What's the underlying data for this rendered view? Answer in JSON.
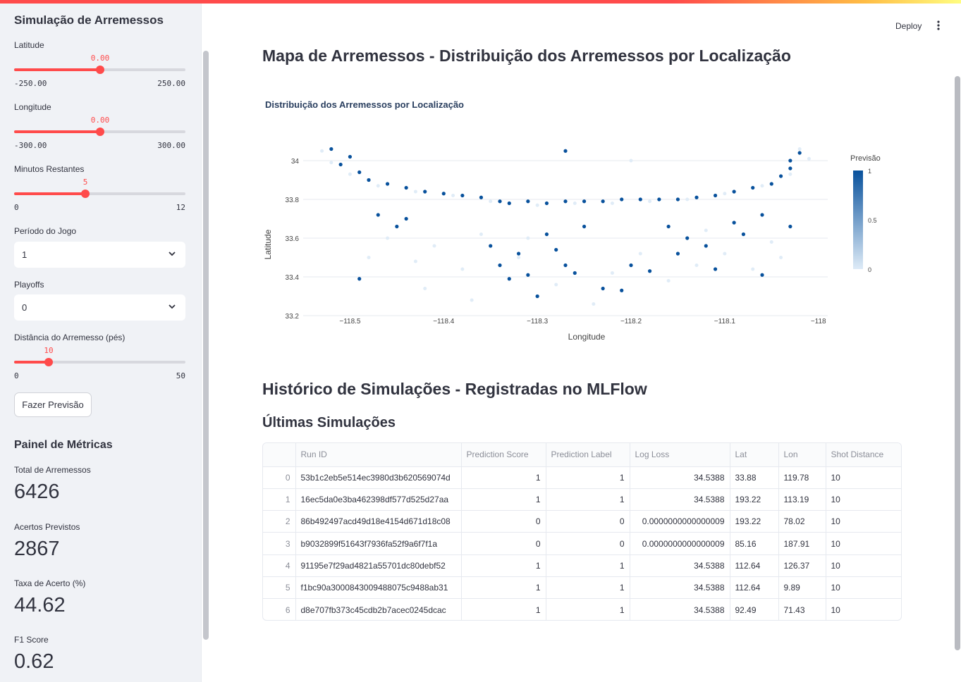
{
  "sidebar": {
    "title": "Simulação de Arremessos",
    "sliders": [
      {
        "label": "Latitude",
        "value": "0.00",
        "min": "-250.00",
        "max": "250.00",
        "fraction": 0.5
      },
      {
        "label": "Longitude",
        "value": "0.00",
        "min": "-300.00",
        "max": "300.00",
        "fraction": 0.5
      },
      {
        "label": "Minutos Restantes",
        "value": "5",
        "min": "0",
        "max": "12",
        "fraction": 0.4167
      },
      {
        "label": "Distância do Arremesso (pés)",
        "value": "10",
        "min": "0",
        "max": "50",
        "fraction": 0.2
      }
    ],
    "selects": [
      {
        "label": "Período do Jogo",
        "value": "1"
      },
      {
        "label": "Playoffs",
        "value": "0"
      }
    ],
    "button": "Fazer Previsão",
    "metrics_title": "Painel de Métricas",
    "metrics": [
      {
        "label": "Total de Arremessos",
        "value": "6426"
      },
      {
        "label": "Acertos Previstos",
        "value": "2867"
      },
      {
        "label": "Taxa de Acerto (%)",
        "value": "44.62"
      },
      {
        "label": "F1 Score",
        "value": "0.62"
      }
    ]
  },
  "header": {
    "deploy": "Deploy"
  },
  "main": {
    "map_title": "Mapa de Arremessos - Distribuição dos Arremessos por Localização",
    "history_title": "Histórico de Simulações - Registradas no MLFlow",
    "last_title": "Últimas Simulações"
  },
  "chart_data": {
    "type": "scatter",
    "title": "Distribuição dos Arremessos por Localização",
    "xlabel": "Longitude",
    "ylabel": "Latitude",
    "xlim": [
      -118.55,
      -117.99
    ],
    "ylim": [
      33.2,
      34.08
    ],
    "x_ticks": [
      "−118.5",
      "−118.4",
      "−118.3",
      "−118.2",
      "−118.1",
      "−118"
    ],
    "x_tick_values": [
      -118.5,
      -118.4,
      -118.3,
      -118.2,
      -118.1,
      -118.0
    ],
    "y_ticks": [
      "34",
      "33.8",
      "33.6",
      "33.4",
      "33.2"
    ],
    "y_tick_values": [
      34.0,
      33.8,
      33.6,
      33.4,
      33.2
    ],
    "colorbar": {
      "title": "Previsão",
      "ticks": [
        "1",
        "0.5",
        "0"
      ],
      "low_color": "#deebf7",
      "high_color": "#08519c"
    },
    "grid": true,
    "points_hit": [
      [
        -118.52,
        34.06
      ],
      [
        -118.5,
        34.02
      ],
      [
        -118.51,
        33.98
      ],
      [
        -118.49,
        33.94
      ],
      [
        -118.48,
        33.9
      ],
      [
        -118.46,
        33.88
      ],
      [
        -118.44,
        33.86
      ],
      [
        -118.42,
        33.84
      ],
      [
        -118.4,
        33.83
      ],
      [
        -118.38,
        33.82
      ],
      [
        -118.36,
        33.81
      ],
      [
        -118.34,
        33.79
      ],
      [
        -118.33,
        33.78
      ],
      [
        -118.31,
        33.79
      ],
      [
        -118.29,
        33.78
      ],
      [
        -118.27,
        33.79
      ],
      [
        -118.25,
        33.79
      ],
      [
        -118.23,
        33.79
      ],
      [
        -118.21,
        33.8
      ],
      [
        -118.19,
        33.8
      ],
      [
        -118.17,
        33.8
      ],
      [
        -118.15,
        33.8
      ],
      [
        -118.13,
        33.81
      ],
      [
        -118.11,
        33.82
      ],
      [
        -118.09,
        33.84
      ],
      [
        -118.07,
        33.86
      ],
      [
        -118.05,
        33.88
      ],
      [
        -118.04,
        33.92
      ],
      [
        -118.03,
        33.96
      ],
      [
        -118.03,
        34.0
      ],
      [
        -118.02,
        34.04
      ],
      [
        -118.27,
        34.05
      ],
      [
        -118.47,
        33.72
      ],
      [
        -118.45,
        33.66
      ],
      [
        -118.44,
        33.7
      ],
      [
        -118.49,
        33.39
      ],
      [
        -118.35,
        33.56
      ],
      [
        -118.34,
        33.46
      ],
      [
        -118.32,
        33.52
      ],
      [
        -118.31,
        33.41
      ],
      [
        -118.3,
        33.3
      ],
      [
        -118.28,
        33.54
      ],
      [
        -118.27,
        33.46
      ],
      [
        -118.26,
        33.42
      ],
      [
        -118.23,
        33.34
      ],
      [
        -118.21,
        33.33
      ],
      [
        -118.2,
        33.46
      ],
      [
        -118.18,
        33.43
      ],
      [
        -118.15,
        33.52
      ],
      [
        -118.14,
        33.6
      ],
      [
        -118.12,
        33.56
      ],
      [
        -118.11,
        33.44
      ],
      [
        -118.09,
        33.68
      ],
      [
        -118.08,
        33.62
      ],
      [
        -118.06,
        33.41
      ],
      [
        -118.03,
        33.66
      ],
      [
        -118.25,
        33.66
      ],
      [
        -118.29,
        33.62
      ],
      [
        -118.16,
        33.66
      ],
      [
        -118.06,
        33.72
      ],
      [
        -118.33,
        33.39
      ]
    ],
    "points_miss": [
      [
        -118.53,
        34.05
      ],
      [
        -118.52,
        33.99
      ],
      [
        -118.5,
        33.93
      ],
      [
        -118.47,
        33.87
      ],
      [
        -118.43,
        33.84
      ],
      [
        -118.39,
        33.82
      ],
      [
        -118.35,
        33.79
      ],
      [
        -118.3,
        33.77
      ],
      [
        -118.26,
        33.78
      ],
      [
        -118.22,
        33.78
      ],
      [
        -118.18,
        33.79
      ],
      [
        -118.14,
        33.8
      ],
      [
        -118.1,
        33.83
      ],
      [
        -118.06,
        33.87
      ],
      [
        -118.03,
        33.93
      ],
      [
        -118.01,
        34.01
      ],
      [
        -118.02,
        34.06
      ],
      [
        -118.46,
        33.6
      ],
      [
        -118.43,
        33.48
      ],
      [
        -118.41,
        33.56
      ],
      [
        -118.38,
        33.44
      ],
      [
        -118.36,
        33.62
      ],
      [
        -118.32,
        33.5
      ],
      [
        -118.28,
        33.36
      ],
      [
        -118.24,
        33.26
      ],
      [
        -118.22,
        33.42
      ],
      [
        -118.19,
        33.52
      ],
      [
        -118.16,
        33.38
      ],
      [
        -118.13,
        33.46
      ],
      [
        -118.1,
        33.52
      ],
      [
        -118.07,
        33.44
      ],
      [
        -118.05,
        33.58
      ],
      [
        -118.2,
        34.0
      ],
      [
        -118.42,
        33.34
      ],
      [
        -118.37,
        33.28
      ],
      [
        -118.31,
        33.6
      ],
      [
        -118.48,
        33.5
      ],
      [
        -118.12,
        33.64
      ],
      [
        -118.04,
        33.5
      ]
    ]
  },
  "table": {
    "columns": [
      "",
      "Run ID",
      "Prediction Score",
      "Prediction Label",
      "Log Loss",
      "Lat",
      "Lon",
      "Shot Distance"
    ],
    "rows": [
      [
        "0",
        "53b1c2eb5e514ec3980d3b620569074d",
        "1",
        "1",
        "34.5388",
        "33.88",
        "119.78",
        "10"
      ],
      [
        "1",
        "16ec5da0e3ba462398df577d525d27aa",
        "1",
        "1",
        "34.5388",
        "193.22",
        "113.19",
        "10"
      ],
      [
        "2",
        "86b492497acd49d18e4154d671d18c08",
        "0",
        "0",
        "0.0000000000000009",
        "193.22",
        "78.02",
        "10"
      ],
      [
        "3",
        "b9032899f51643f7936fa52f9a6f7f1a",
        "0",
        "0",
        "0.0000000000000009",
        "85.16",
        "187.91",
        "10"
      ],
      [
        "4",
        "91195e7f29ad4821a55701dc80debf52",
        "1",
        "1",
        "34.5388",
        "112.64",
        "126.37",
        "10"
      ],
      [
        "5",
        "f1bc90a3000843009488075c9488ab31",
        "1",
        "1",
        "34.5388",
        "112.64",
        "9.89",
        "10"
      ],
      [
        "6",
        "d8e707fb373c45cdb2b7acec0245dcac",
        "1",
        "1",
        "34.5388",
        "92.49",
        "71.43",
        "10"
      ]
    ]
  }
}
